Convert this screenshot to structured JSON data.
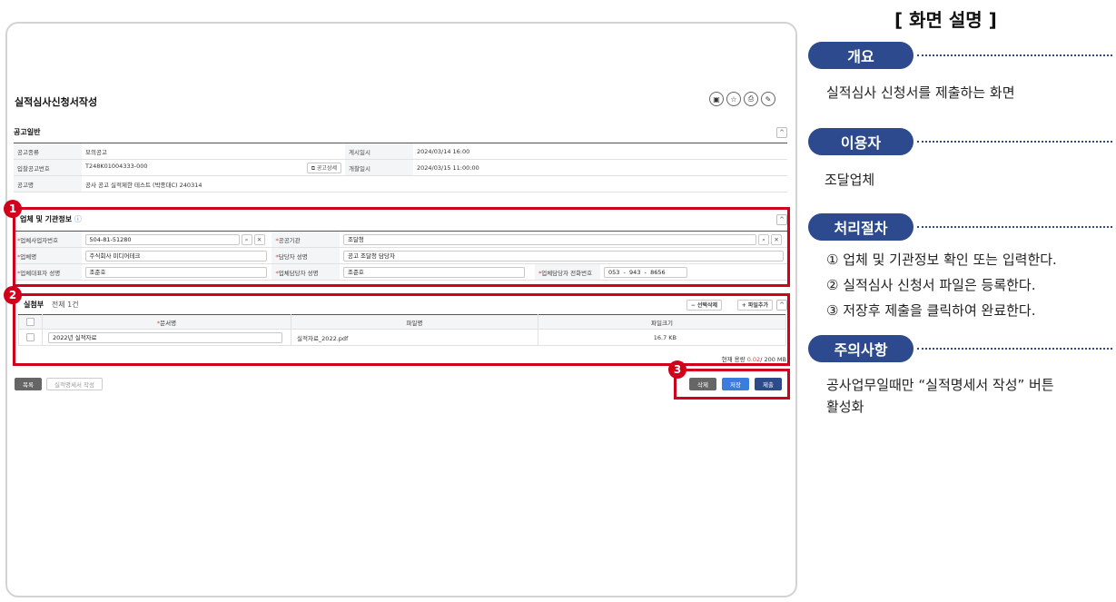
{
  "screen": {
    "page_title": "실적심사신청서작성",
    "title_icons": [
      "save-icon",
      "star-icon",
      "print-icon",
      "settings-icon"
    ],
    "notice_section": {
      "title": "공고일반",
      "rows": [
        {
          "label1": "공고종류",
          "value1": "모의공고",
          "label2": "게시일시",
          "value2": "2024/03/14 16:00"
        },
        {
          "label1": "입찰공고번호",
          "value1": "T248K01004333-000",
          "button": "공고상세",
          "label2": "개찰일시",
          "value2": "2024/03/15 11:00:00"
        },
        {
          "label1": "공고명",
          "value1": "공사 공고 실적제한 테스트 (박종대C) 240314"
        }
      ]
    },
    "company_section": {
      "title": "업체 및 기관정보",
      "rows": [
        {
          "label1": "업체사업자번호",
          "value1": "504-81-51280",
          "label2": "공공기관",
          "value2": "조달청"
        },
        {
          "label1": "업체명",
          "value1": "주식회사 미디어테크",
          "label2": "담당자 성명",
          "value2": "공고 조달청 담당자"
        },
        {
          "label1": "업체대표자 성명",
          "value1": "조준호",
          "label2": "업체담당자 성명",
          "value2": "조준호",
          "label3": "업체담당자 전화번호",
          "phone": [
            "053",
            "943",
            "8656"
          ]
        }
      ]
    },
    "attach_section": {
      "title": "실첨부",
      "count": "전체 1건",
      "btn_delete_selected": "선택삭제",
      "btn_add_file": "파일추가",
      "columns": [
        "문서명",
        "파일명",
        "파일크기"
      ],
      "rows": [
        {
          "doc": "2022년 실적자료",
          "file": "실적자료_2022.pdf",
          "size": "16.7 KB"
        }
      ],
      "capacity_label": "현재 용량",
      "capacity_used": "0.02",
      "capacity_total": "/ 200 MB"
    },
    "bottom_buttons": {
      "list": "목록",
      "write_statement": "실적명세서 작성",
      "delete": "삭제",
      "save": "저장",
      "submit": "제출"
    },
    "markers": [
      "1",
      "2",
      "3"
    ]
  },
  "panel": {
    "title": "[ 화면 설명 ]",
    "sections": [
      {
        "heading": "개요",
        "lines": [
          "실적심사 신청서를 제출하는 화면"
        ]
      },
      {
        "heading": "이용자",
        "lines": [
          "조달업체"
        ]
      },
      {
        "heading": "처리절차",
        "lines": [
          "① 업체 및 기관정보 확인 또는 입력한다.",
          "② 실적심사 신청서 파일은 등록한다.",
          "③ 저장후 제출을 클릭하여 완료한다."
        ]
      },
      {
        "heading": "주의사항",
        "lines": [
          "공사업무일때만 “실적명세서 작성” 버튼",
          "활성화"
        ]
      }
    ]
  },
  "colors": {
    "accent_navy": "#2c4a8d",
    "highlight_red": "#d0021b",
    "save_blue": "#3b7ddd"
  }
}
